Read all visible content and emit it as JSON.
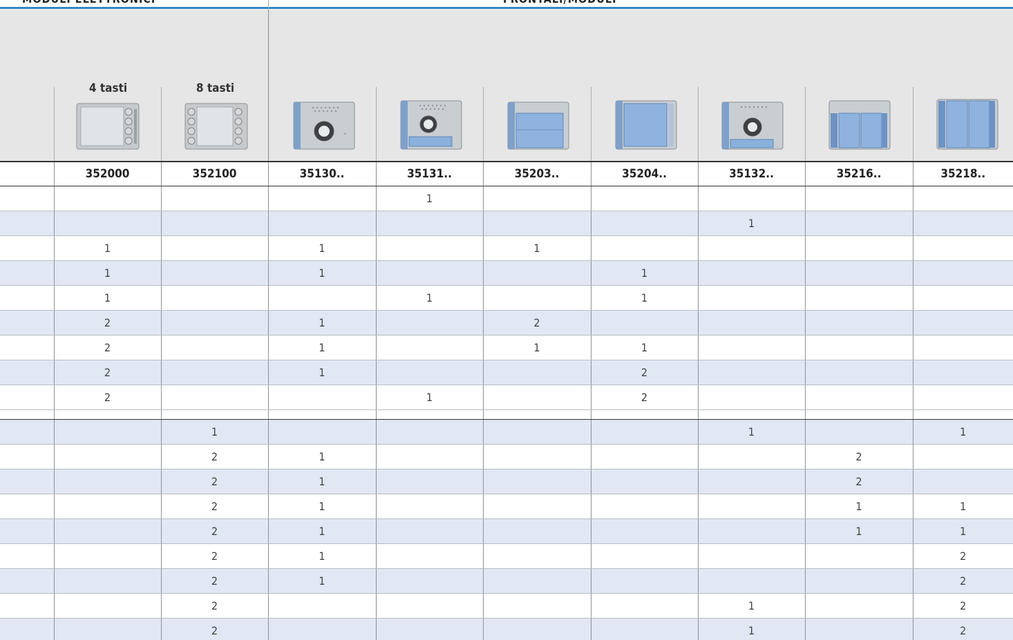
{
  "header": {
    "left_title": "MODULI ELETTRONICI",
    "right_title": "FRONTALI/MODULI"
  },
  "modules": {
    "four_keys_label": "4 tasti",
    "eight_keys_label": "8 tasti"
  },
  "codes": [
    "352000",
    "352100",
    "35130..",
    "35131..",
    "35203..",
    "35204..",
    "35132..",
    "35216..",
    "35218.."
  ],
  "group1_rows": [
    [
      "",
      "",
      "",
      "1",
      "",
      "",
      "",
      "",
      ""
    ],
    [
      "",
      "",
      "",
      "",
      "",
      "",
      "1",
      "",
      ""
    ],
    [
      "1",
      "",
      "1",
      "",
      "1",
      "",
      "",
      "",
      ""
    ],
    [
      "1",
      "",
      "1",
      "",
      "",
      "1",
      "",
      "",
      ""
    ],
    [
      "1",
      "",
      "",
      "1",
      "",
      "1",
      "",
      "",
      ""
    ],
    [
      "2",
      "",
      "1",
      "",
      "2",
      "",
      "",
      "",
      ""
    ],
    [
      "2",
      "",
      "1",
      "",
      "1",
      "1",
      "",
      "",
      ""
    ],
    [
      "2",
      "",
      "1",
      "",
      "",
      "2",
      "",
      "",
      ""
    ],
    [
      "2",
      "",
      "",
      "1",
      "",
      "2",
      "",
      "",
      ""
    ]
  ],
  "group2_rows": [
    [
      "",
      "1",
      "",
      "",
      "",
      "",
      "1",
      "",
      "1"
    ],
    [
      "",
      "2",
      "1",
      "",
      "",
      "",
      "",
      "2",
      ""
    ],
    [
      "",
      "2",
      "1",
      "",
      "",
      "",
      "",
      "2",
      ""
    ],
    [
      "",
      "2",
      "1",
      "",
      "",
      "",
      "",
      "1",
      "1"
    ],
    [
      "",
      "2",
      "1",
      "",
      "",
      "",
      "",
      "1",
      "1"
    ],
    [
      "",
      "2",
      "1",
      "",
      "",
      "",
      "",
      "",
      "2"
    ],
    [
      "",
      "2",
      "1",
      "",
      "",
      "",
      "",
      "",
      "2"
    ],
    [
      "",
      "2",
      "",
      "",
      "",
      "",
      "1",
      "",
      "2"
    ],
    [
      "",
      "2",
      "",
      "",
      "",
      "",
      "1",
      "",
      "2"
    ]
  ],
  "colors": {
    "accent_blue": "#2f86c4",
    "row_alt": "#e1e8f4",
    "band_gray": "#e6e6e6"
  }
}
